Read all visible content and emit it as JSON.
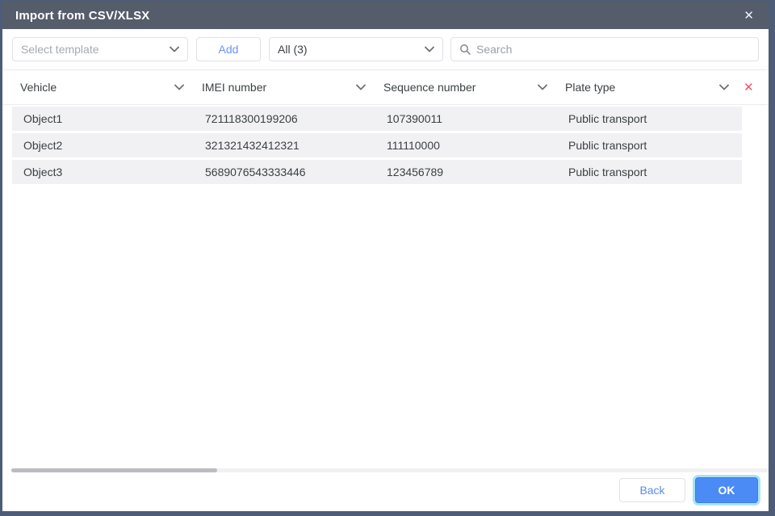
{
  "dialog": {
    "title": "Import from CSV/XLSX",
    "close_icon": "✕"
  },
  "toolbar": {
    "template_dropdown": {
      "placeholder": "Select template"
    },
    "add_button_label": "Add",
    "filter_dropdown": {
      "value": "All (3)"
    },
    "search": {
      "placeholder": "Search"
    }
  },
  "table": {
    "columns": [
      {
        "label": "Vehicle"
      },
      {
        "label": "IMEI number"
      },
      {
        "label": "Sequence number"
      },
      {
        "label": "Plate type"
      }
    ],
    "remove_columns_icon": "✕",
    "rows": [
      {
        "vehicle": "Object1",
        "imei": "721118300199206",
        "sequence": "107390011",
        "plate": "Public transport"
      },
      {
        "vehicle": "Object2",
        "imei": "321321432412321",
        "sequence": "111110000",
        "plate": "Public transport"
      },
      {
        "vehicle": "Object3",
        "imei": "5689076543333446",
        "sequence": "123456789",
        "plate": "Public transport"
      }
    ]
  },
  "footer": {
    "back_label": "Back",
    "ok_label": "OK"
  },
  "colors": {
    "titlebar_bg": "#565d6a",
    "frame_border": "#4e5c77",
    "accent_blue": "#4a8bf5",
    "link_blue": "#5f8cf5",
    "danger_red": "#f45064",
    "row_bg": "#f1f1f4",
    "focus_ring": "#a8e4f2"
  }
}
